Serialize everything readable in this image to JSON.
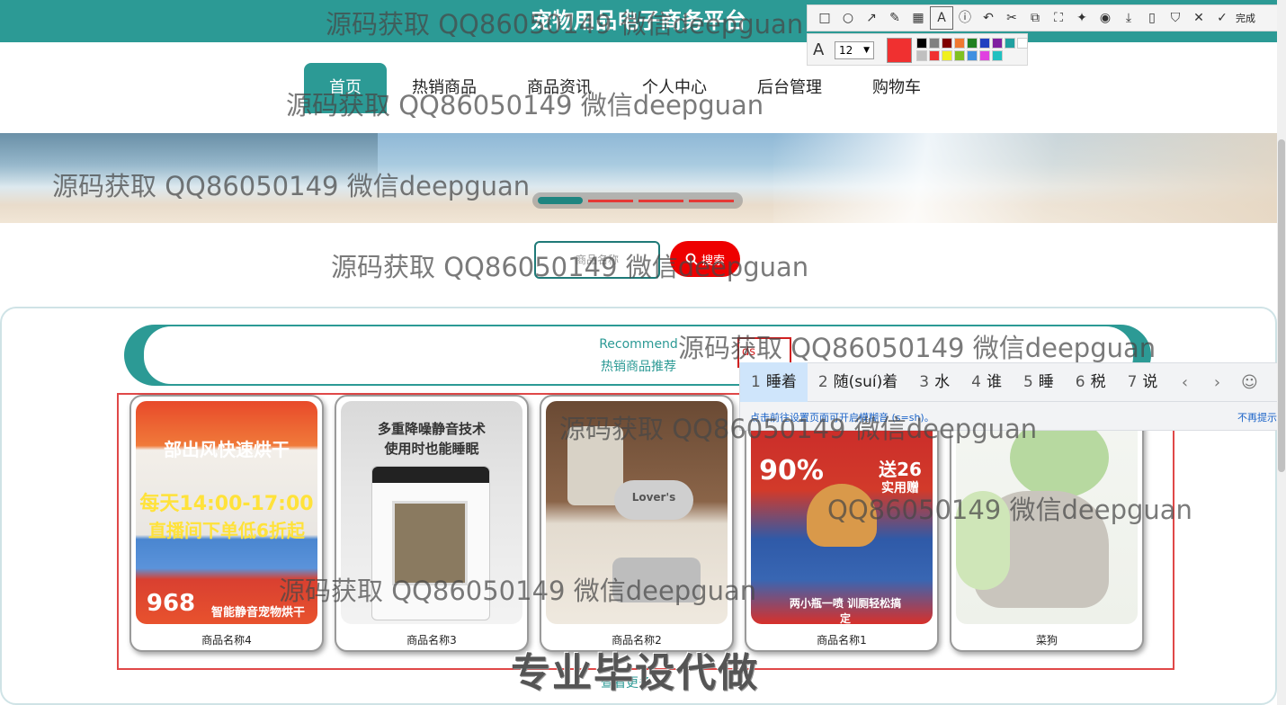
{
  "header": {
    "title": "宠物用品电子商务平台"
  },
  "nav": {
    "items": [
      {
        "label": "首页"
      },
      {
        "label": "热销商品"
      },
      {
        "label": "商品资讯"
      },
      {
        "label": "个人中心"
      },
      {
        "label": "后台管理"
      },
      {
        "label": "购物车"
      }
    ]
  },
  "search": {
    "placeholder": "商品名称",
    "button_label": "搜索"
  },
  "recommend": {
    "en": "Recommend",
    "cn": "热销商品推荐"
  },
  "products": [
    {
      "name": "商品名称4",
      "img_text_top": "部出风快速烘干",
      "img_text_mid": "每天14:00-17:00",
      "img_text_mid2": "直播间下单低6折起",
      "img_text_bot": "智能静音宠物烘干",
      "price": "968"
    },
    {
      "name": "商品名称3",
      "img_text_top": "多重降噪静音技术",
      "img_text_top2": "使用时也能睡眠"
    },
    {
      "name": "商品名称2",
      "img_text_top": "Lover's"
    },
    {
      "name": "商品名称1",
      "img_text_top": "90%",
      "img_text_mid": "送26",
      "img_text_mid2": "实用赠",
      "img_text_bot": "两小瓶一喷 训厕轻松搞定"
    },
    {
      "name": "菜狗"
    }
  ],
  "more_label": "查看更多",
  "snip_toolbar": {
    "done_label": "完成",
    "font_size": "12",
    "current_color": "#f03030",
    "palette": [
      "#000000",
      "#808080",
      "#800000",
      "#f07830",
      "#208020",
      "#2040c0",
      "#8020a0",
      "#20a0a0",
      "#ffffff",
      "#c0c0c0",
      "#f03030",
      "#f0f020",
      "#80c020",
      "#4090e0",
      "#e040e0",
      "#20c0c0"
    ]
  },
  "ime": {
    "composition": "ds",
    "candidates": [
      {
        "n": "1",
        "text": "睡着"
      },
      {
        "n": "2",
        "text": "随(suí)着"
      },
      {
        "n": "3",
        "text": "水"
      },
      {
        "n": "4",
        "text": "谁"
      },
      {
        "n": "5",
        "text": "睡"
      },
      {
        "n": "6",
        "text": "税"
      },
      {
        "n": "7",
        "text": "说"
      }
    ],
    "hint": "点击前往设置页面可开启模糊音 (s=sh)。",
    "dismiss": "不再提示",
    "emoji": "☺"
  },
  "watermarks": {
    "text": "源码获取 QQ86050149 微信deepguan",
    "text_short": "QQ86050149 微信deepguan",
    "banner": "专业毕设代做"
  },
  "colors": {
    "brand": "#2c9a95",
    "search_button": "#ee0000",
    "product_border": "#e04848"
  }
}
